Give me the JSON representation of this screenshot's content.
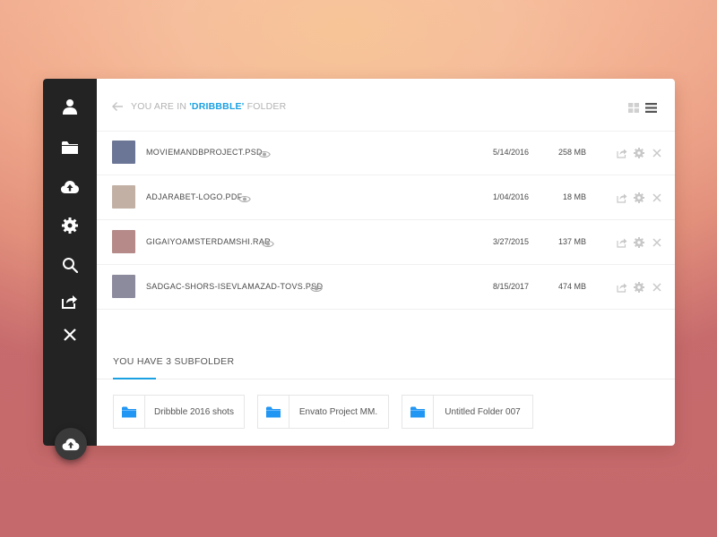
{
  "header": {
    "crumb_prefix": "YOU ARE IN ",
    "crumb_folder": "'DRIBBBLE'",
    "crumb_suffix": " FOLDER"
  },
  "files": [
    {
      "name": "MOVIEMANDBPROJECT.PSD",
      "date": "5/14/2016",
      "size": "258 MB",
      "thumb_color": "#6b7595"
    },
    {
      "name": "ADJARABET-LOGO.PDF",
      "date": "1/04/2016",
      "size": "18 MB",
      "thumb_color": "#c3b0a5"
    },
    {
      "name": "GIGAIYOAMSTERDAMSHI.RAR",
      "date": "3/27/2015",
      "size": "137 MB",
      "thumb_color": "#b58a88"
    },
    {
      "name": "SADGAC-SHORS-ISEVLAMAZAD-TOVS.PSD",
      "date": "8/15/2017",
      "size": "474 MB",
      "thumb_color": "#8c8a9d"
    }
  ],
  "subfolders": {
    "title": "YOU HAVE 3 SUBFOLDER",
    "items": [
      {
        "label": "Dribbble 2016 shots"
      },
      {
        "label": "Envato Project MM."
      },
      {
        "label": "Untitled Folder 007"
      }
    ]
  },
  "colors": {
    "accent": "#1ba1e2",
    "sidebar": "#232323",
    "folder_icon": "#2196f3"
  },
  "icons": {
    "sidebar": [
      "user-icon",
      "folder-icon",
      "cloud-upload-icon",
      "gear-icon",
      "search-icon",
      "share-icon",
      "close-icon"
    ],
    "fab": "cloud-upload-icon"
  }
}
